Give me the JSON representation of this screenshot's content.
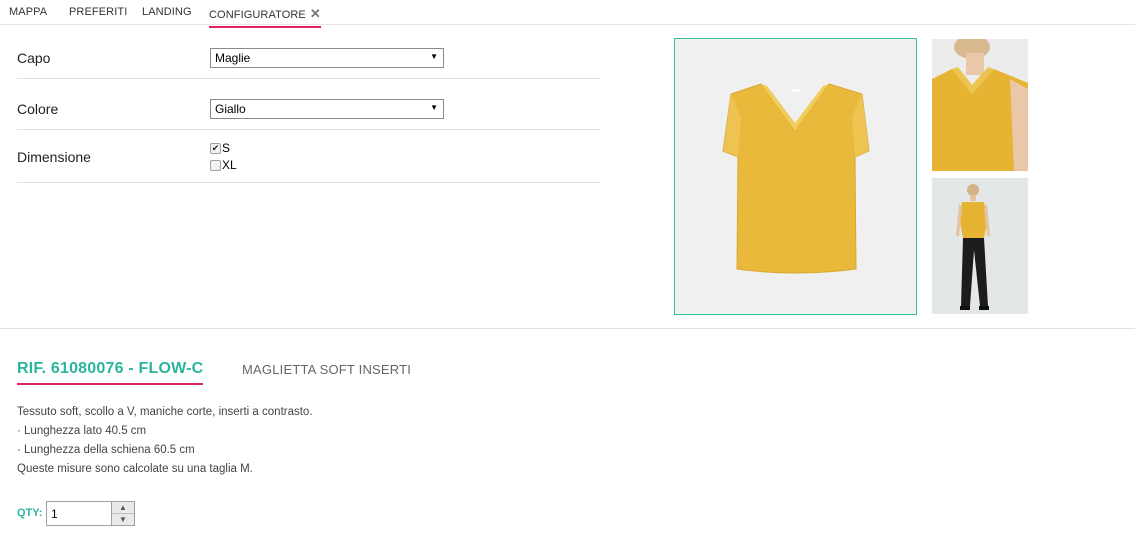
{
  "tabs": [
    {
      "label": "MAPPA"
    },
    {
      "label": "PREFERITI"
    },
    {
      "label": "LANDING"
    },
    {
      "label": "CONFIGURATORE",
      "active": true,
      "close": "✕"
    }
  ],
  "configurator": {
    "capo": {
      "label": "Capo",
      "value": "Maglie"
    },
    "colore": {
      "label": "Colore",
      "value": "Giallo"
    },
    "dimensione": {
      "label": "Dimensione",
      "options": [
        {
          "label": "S",
          "checked": true
        },
        {
          "label": "XL",
          "checked": false
        }
      ]
    }
  },
  "product": {
    "ref": "RIF. 61080076 - FLOW-C",
    "name": "MAGLIETTA SOFT INSERTI",
    "description": [
      "Tessuto soft, scollo a V, maniche corte, inserti a contrasto.",
      "· Lunghezza lato 40.5 cm",
      "· Lunghezza della schiena 60.5 cm",
      "Queste misure sono calcolate su una taglia M."
    ],
    "qty_label": "QTY:",
    "qty_value": "1"
  },
  "colors": {
    "accent_teal": "#2ab59c",
    "accent_pink": "#e0245e",
    "shirt_yellow": "#e8b93a"
  }
}
